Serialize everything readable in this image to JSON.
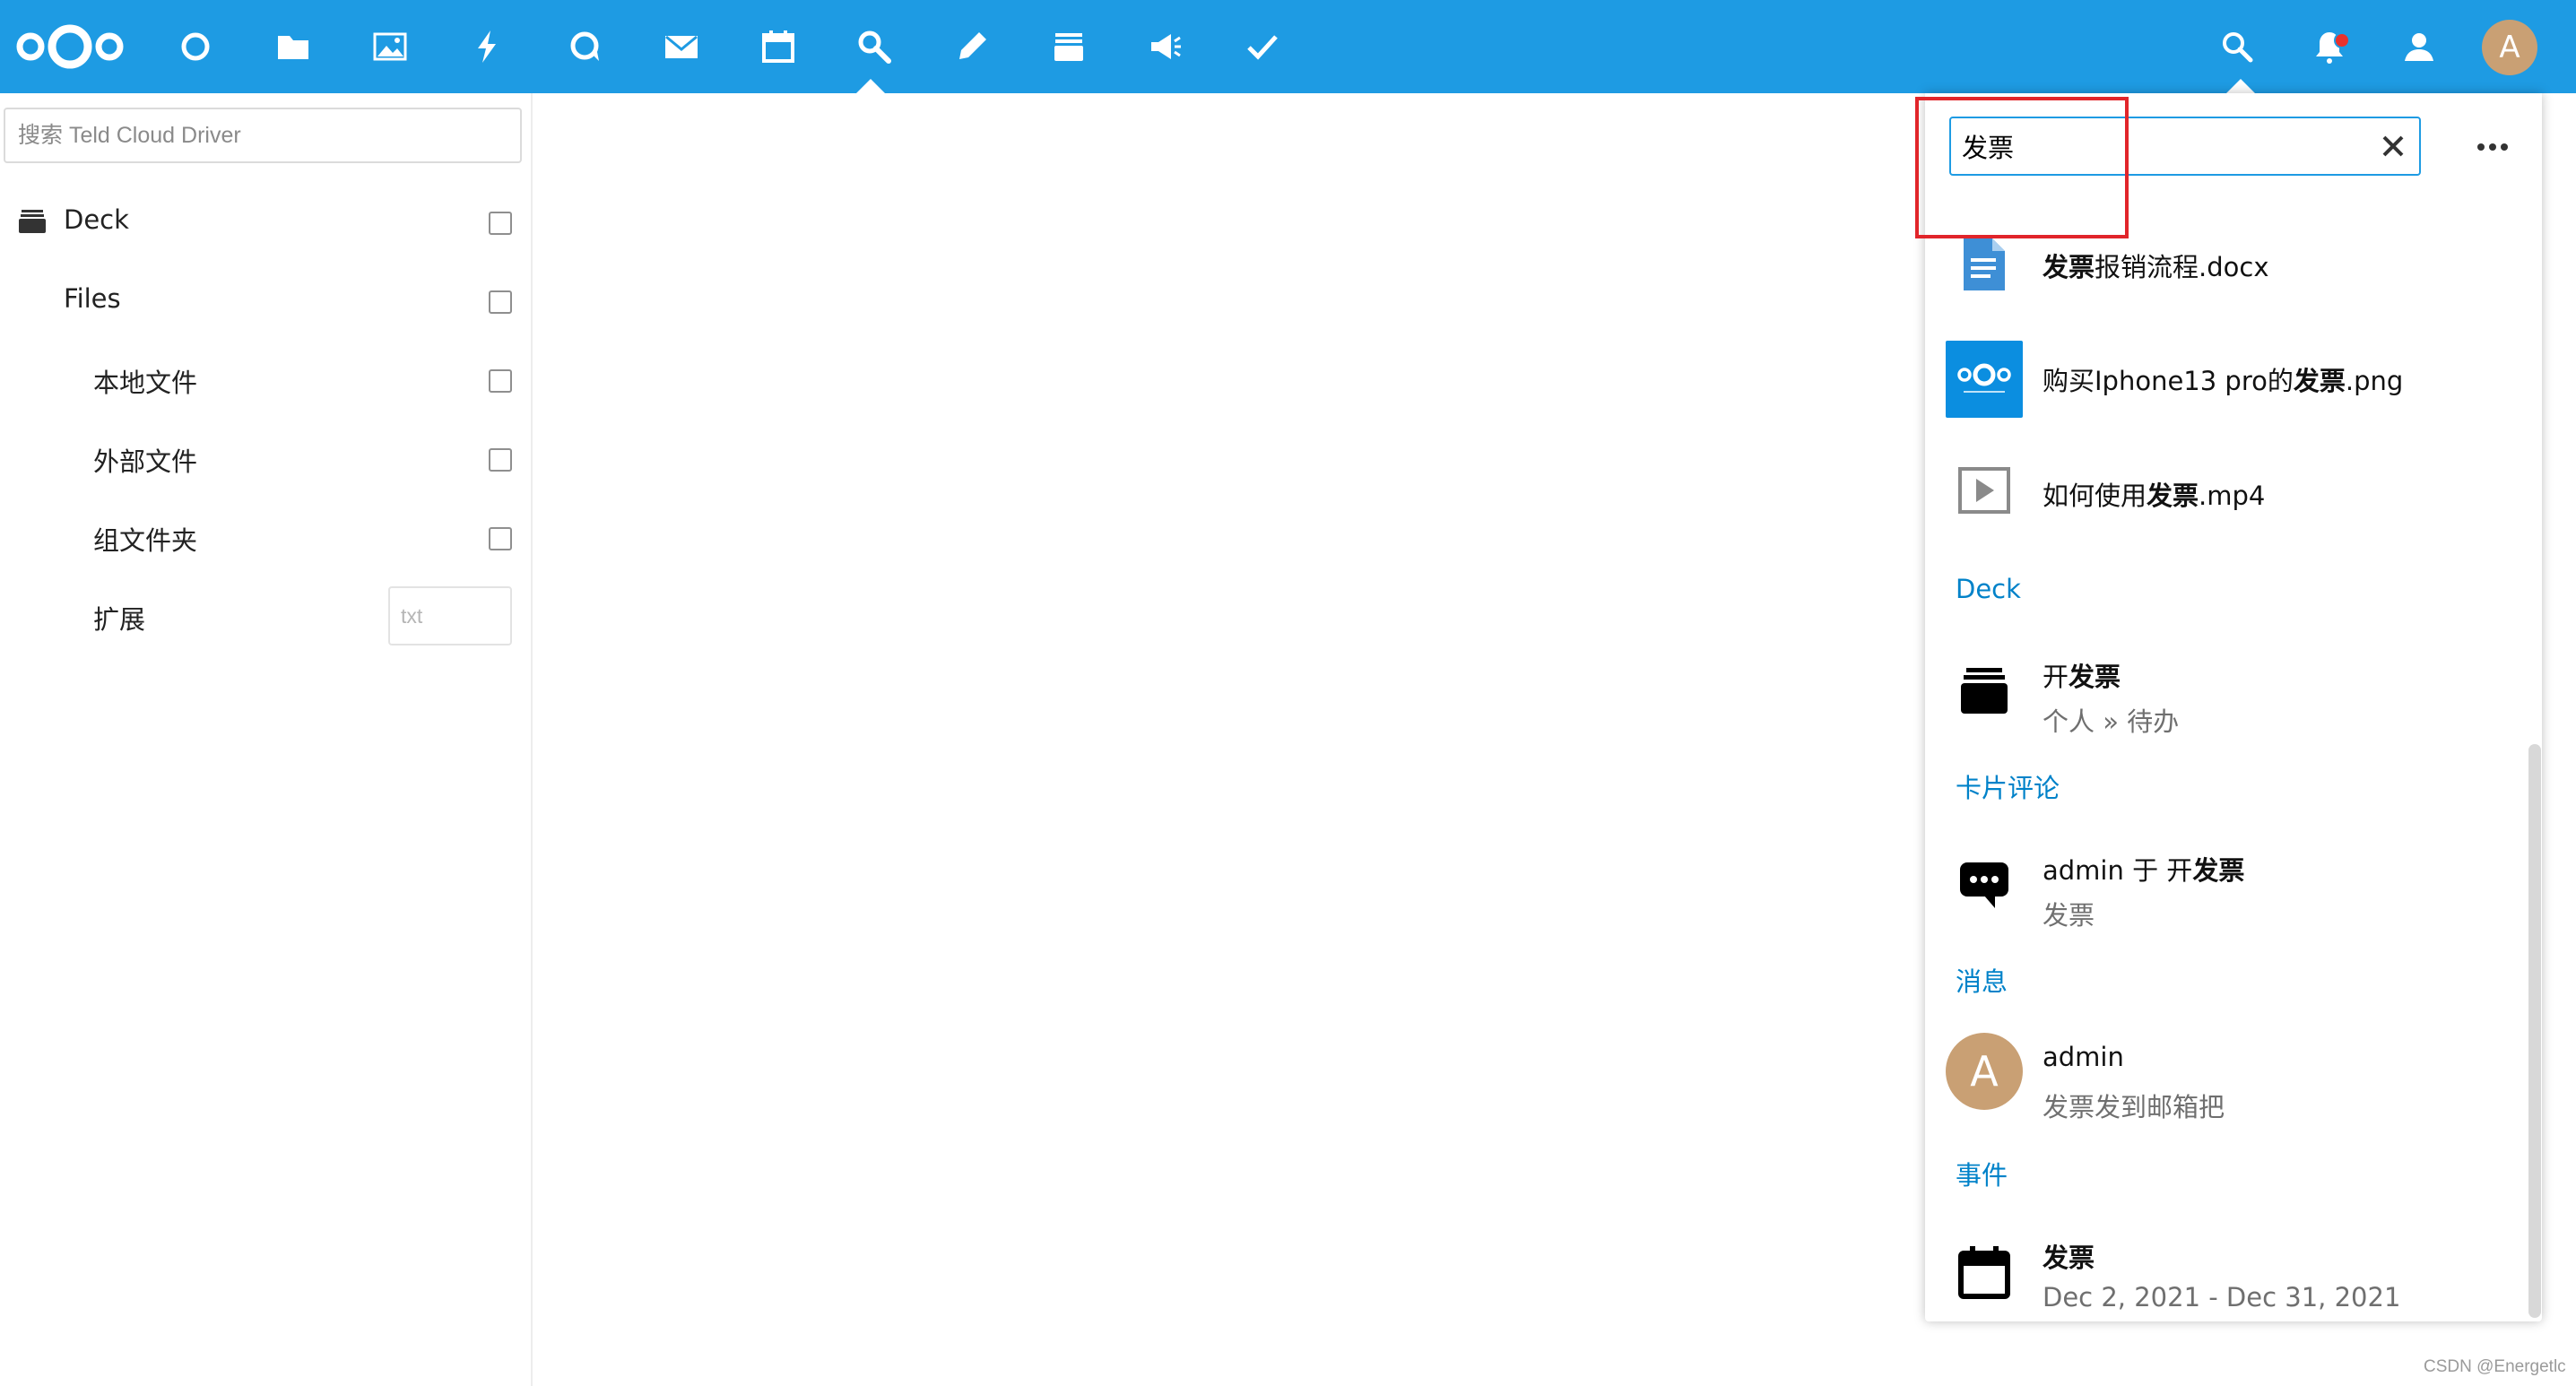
{
  "colors": {
    "header_bg": "#1e9be3",
    "link": "#0082c9",
    "highlight_box": "#e1252a",
    "avatar": "#c9a074"
  },
  "header": {
    "app_icons": [
      "dashboard-icon",
      "files-icon",
      "photos-icon",
      "activity-icon",
      "talk-icon",
      "mail-icon",
      "calendar-icon",
      "search-app-icon",
      "notes-icon",
      "deck-icon",
      "announcements-icon",
      "tasks-icon"
    ],
    "right_icons": [
      "search-icon",
      "notifications-icon",
      "contacts-icon"
    ],
    "avatar_letter": "A"
  },
  "sidebar": {
    "filter_placeholder": "搜索 Teld Cloud Driver",
    "items": [
      {
        "label": "Deck",
        "icon": "deck-icon"
      },
      {
        "label": "Files"
      },
      {
        "label": "本地文件"
      },
      {
        "label": "外部文件"
      },
      {
        "label": "组文件夹"
      },
      {
        "label": "扩展",
        "input_placeholder": "txt"
      }
    ]
  },
  "search": {
    "query": "发票",
    "results_files": [
      {
        "pre": "",
        "bold": "发票",
        "post": "报销流程.docx",
        "icon": "document-icon"
      },
      {
        "pre": "购买Iphone13 pro的",
        "bold": "发票",
        "post": ".png",
        "icon": "image-thumbnail"
      },
      {
        "pre": "如何使用",
        "bold": "发票",
        "post": ".mp4",
        "icon": "video-icon"
      }
    ],
    "sections": [
      {
        "label": "Deck",
        "result": {
          "pre": "开",
          "bold": "发票",
          "post": "",
          "sub": "个人 » 待办",
          "icon": "deck-icon"
        }
      },
      {
        "label": "卡片评论",
        "result": {
          "pre": "admin 于 开",
          "bold": "发票",
          "post": "",
          "sub": "发票",
          "icon": "comment-icon"
        }
      },
      {
        "label": "消息",
        "result": {
          "pre": "admin",
          "bold": "",
          "post": "",
          "sub": "发票发到邮箱把",
          "icon": "avatar",
          "avatar_letter": "A"
        }
      },
      {
        "label": "事件",
        "result": {
          "pre": "",
          "bold": "发票",
          "post": "",
          "sub": "Dec 2, 2021 - Dec 31, 2021",
          "icon": "calendar-icon"
        }
      }
    ]
  },
  "watermark": "CSDN @Energetlc"
}
